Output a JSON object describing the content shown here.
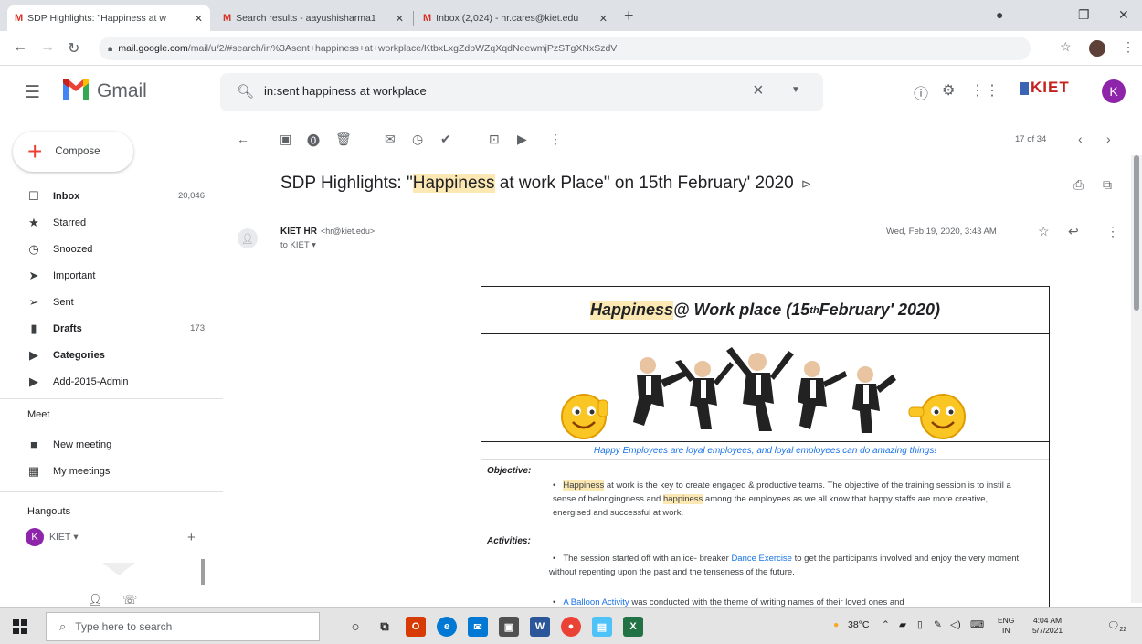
{
  "browser": {
    "tabs": [
      {
        "label": "SDP Highlights: \"Happiness at w",
        "active": true
      },
      {
        "label": "Search results - aayushisharma1",
        "active": false
      },
      {
        "label": "Inbox (2,024) - hr.cares@kiet.edu",
        "active": false
      }
    ],
    "url_host": "mail.google.com",
    "url_path": "/mail/u/2/#search/in%3Asent+happiness+at+workplace/KtbxLxgZdpWZqXqdNeewmjPzSTgXNxSzdV"
  },
  "gmail": {
    "brand": "Gmail",
    "search_query": "in:sent happiness at workplace",
    "org_logo": "KIET",
    "avatar_letter": "K"
  },
  "sidebar": {
    "compose_label": "Compose",
    "items": [
      {
        "label": "Inbox",
        "count": "20,046",
        "icon": "inbox-icon",
        "glyph": "☐",
        "bold": true
      },
      {
        "label": "Starred",
        "count": "",
        "icon": "star-icon",
        "glyph": "★",
        "bold": false
      },
      {
        "label": "Snoozed",
        "count": "",
        "icon": "clock-icon",
        "glyph": "◷",
        "bold": false
      },
      {
        "label": "Important",
        "count": "",
        "icon": "important-icon",
        "glyph": "➤",
        "bold": false
      },
      {
        "label": "Sent",
        "count": "",
        "icon": "send-icon",
        "glyph": "➢",
        "bold": false
      },
      {
        "label": "Drafts",
        "count": "173",
        "icon": "draft-icon",
        "glyph": "▮",
        "bold": true
      },
      {
        "label": "Categories",
        "count": "",
        "icon": "label-icon",
        "glyph": "▶",
        "bold": true
      },
      {
        "label": "Add-2015-Admin",
        "count": "",
        "icon": "label-icon",
        "glyph": "▶",
        "bold": false
      }
    ],
    "meet_title": "Meet",
    "meet_items": [
      {
        "label": "New meeting",
        "icon": "video-icon",
        "glyph": "■"
      },
      {
        "label": "My meetings",
        "icon": "calendar-icon",
        "glyph": "▦"
      }
    ],
    "hangouts_title": "Hangouts",
    "hangout_user": "KIET",
    "hangout_user_letter": "K"
  },
  "message": {
    "pager": "17 of 34",
    "subject_pre": "SDP Highlights: \"",
    "subject_hl": "Happiness",
    "subject_post": " at work Place\" on 15th February' 2020",
    "sender_name": "KIET HR",
    "sender_email": "<hr@kiet.edu>",
    "to_line": "to KIET ▾",
    "date": "Wed, Feb 19, 2020, 3:43 AM"
  },
  "poster": {
    "title_hl": "Happiness",
    "title_mid": " @ Work place (15",
    "title_sup": "th",
    "title_post": " February' 2020)",
    "tagline": "Happy Employees are loyal employees, and loyal employees can do amazing things!",
    "objective_label": "Objective:",
    "obj_hl1": "Happiness",
    "obj_t1": " at work is the key to create engaged & productive teams. The objective of the training session is to instil a sense of belongingness and ",
    "obj_hl2": "happiness",
    "obj_t2": " among the employees as we all know that happy staffs are more creative, energised and successful at work.",
    "activities_label": "Activities:",
    "act1_pre": "The session started off with an ice- breaker ",
    "act1_link": "Dance Exercise",
    "act1_post": " to get the participants involved and enjoy the very moment without repenting upon the past and the tenseness of the future.",
    "act2_link": "A Balloon Activity",
    "act2_post": " was conducted with the theme of writing names of their loved ones and"
  },
  "taskbar": {
    "search_placeholder": "Type here to search",
    "weather": "38°C",
    "lang1": "ENG",
    "lang2": "IN",
    "time": "4:04 AM",
    "date": "5/7/2021",
    "notif": "22"
  }
}
